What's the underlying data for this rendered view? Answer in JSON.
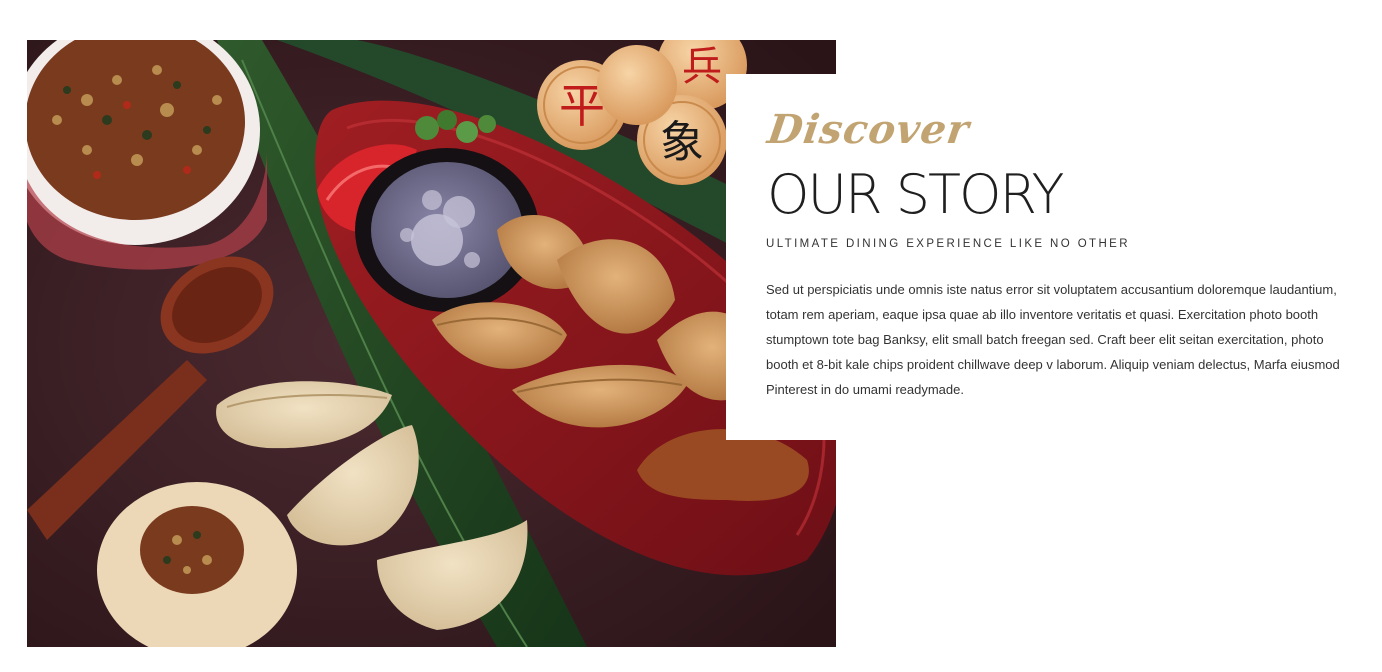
{
  "hero_image": {
    "alt": "Dumplings on a red plate with dipping sauce, filling bowl, wooden spoon and Chinese chess pieces",
    "chess_piece_glyphs": [
      "平",
      "兵",
      "象"
    ]
  },
  "story": {
    "eyebrow": "Discover",
    "title": "OUR STORY",
    "subtitle": "ULTIMATE DINING EXPERIENCE LIKE NO OTHER",
    "body": "Sed ut perspiciatis unde omnis iste natus error sit voluptatem accusantium doloremque laudantium, totam rem aperiam, eaque ipsa quae ab illo inventore veritatis et quasi. Exercitation photo booth stumptown tote bag Banksy, elit small batch freegan sed. Craft beer elit seitan exercitation, photo booth et 8-bit kale chips proident chillwave deep v laborum. Aliquip veniam delectus, Marfa eiusmod Pinterest in do umami readymade."
  },
  "colors": {
    "accent_gold": "#c2a472",
    "heading": "#1f1f1f",
    "text": "#333333",
    "background": "#ffffff"
  }
}
